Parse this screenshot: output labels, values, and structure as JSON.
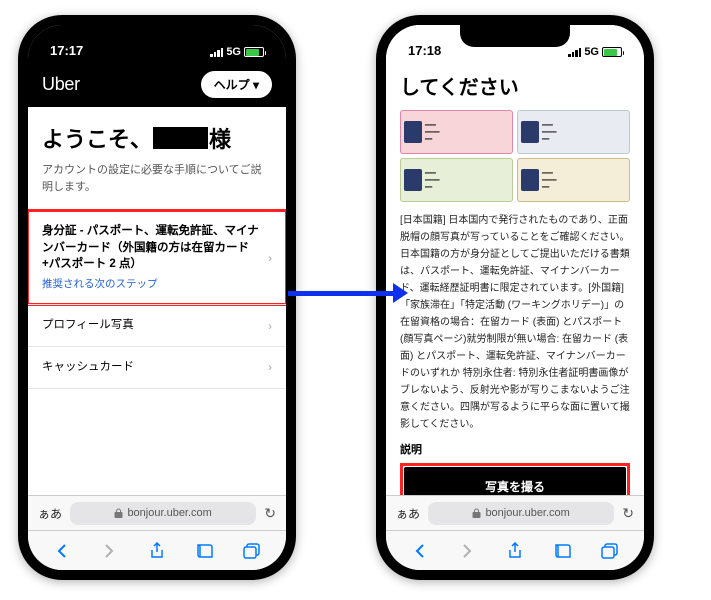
{
  "phone1": {
    "time": "17:17",
    "net": "5G",
    "brand": "Uber",
    "help": "ヘルプ ▾",
    "welcome_pre": "ようこそ、",
    "welcome_post": "様",
    "welcome_sub": "アカウントの設定に必要な手順についてご説明します。",
    "row1_title": "身分証 - パスポート、運転免許証、マイナンバーカード（外国籍の方は在留カード+パスポート 2 点）",
    "row1_sub": "推奨される次のステップ",
    "row2": "プロフィール写真",
    "row3": "キャッシュカード",
    "aa": "ぁあ",
    "url": "bonjour.uber.com"
  },
  "phone2": {
    "time": "17:18",
    "net": "5G",
    "title": "してください",
    "body": "[日本国籍] 日本国内で発行されたものであり、正面脱帽の顔写真が写っていることをご確認ください。日本国籍の方が身分証としてご提出いただける書類は、パスポート、運転免許証、マイナンバーカード、運転経歴証明書に限定されています。[外国籍] 「家族滞在」「特定活動 (ワーキングホリデー)」の在留資格の場合：在留カード (表面) とパスポート(顔写真ページ)就労制限が無い場合: 在留カード (表面) とパスポート、運転免許証、マイナンバーカードのいずれか  特別永住者: 特別永住者証明書画像がブレないよう、反射光や影が写りこまないようご注意ください。四隅が写るように平らな面に置いて撮影してください。",
    "explain": "説明",
    "capture": "写真を撮る",
    "aa": "ぁあ",
    "url": "bonjour.uber.com"
  }
}
